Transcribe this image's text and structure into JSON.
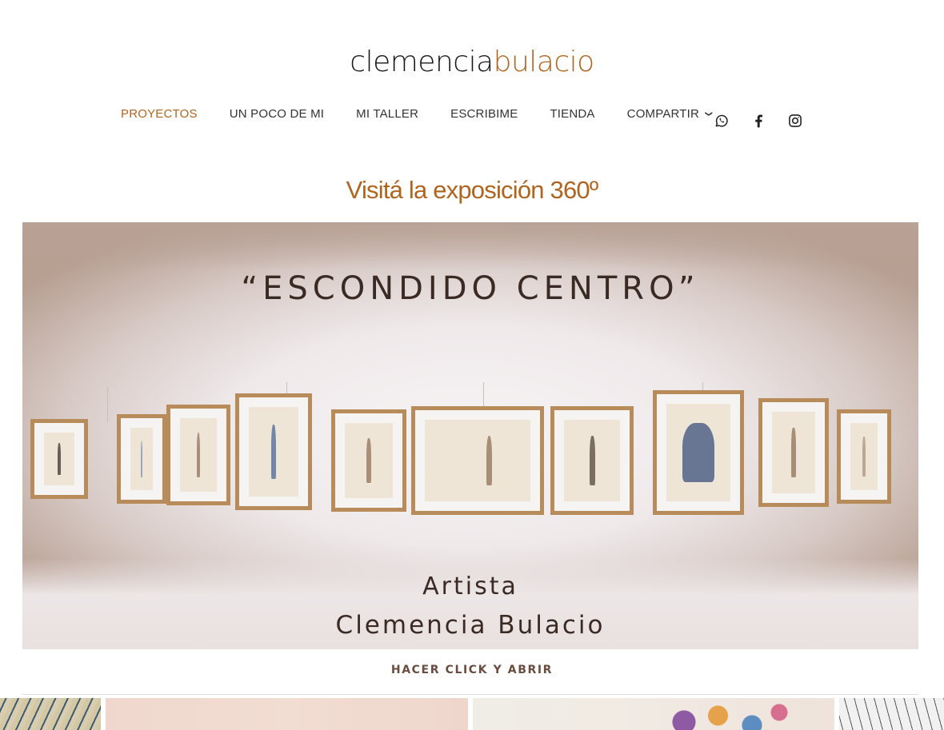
{
  "header": {
    "logo_first": "clemencia",
    "logo_second": "bulacio",
    "brand_color": "#b0651e"
  },
  "nav": {
    "items": [
      {
        "label": "PROYECTOS",
        "active": true
      },
      {
        "label": "UN POCO DE MI",
        "active": false
      },
      {
        "label": "MI TALLER",
        "active": false
      },
      {
        "label": "ESCRIBIME",
        "active": false
      },
      {
        "label": "TIENDA",
        "active": false
      },
      {
        "label": "COMPARTIR",
        "active": false,
        "has_dropdown": true
      }
    ],
    "chevron_glyph": "❯"
  },
  "social": {
    "icons": [
      "whatsapp-icon",
      "facebook-icon",
      "instagram-icon"
    ]
  },
  "main": {
    "heading": "Visitá la exposición 360º",
    "hero": {
      "title": "“ESCONDIDO CENTRO”",
      "artist_label": "Artista",
      "artist_name": "Clemencia Bulacio"
    },
    "cta": "HACER CLICK Y ABRIR"
  }
}
